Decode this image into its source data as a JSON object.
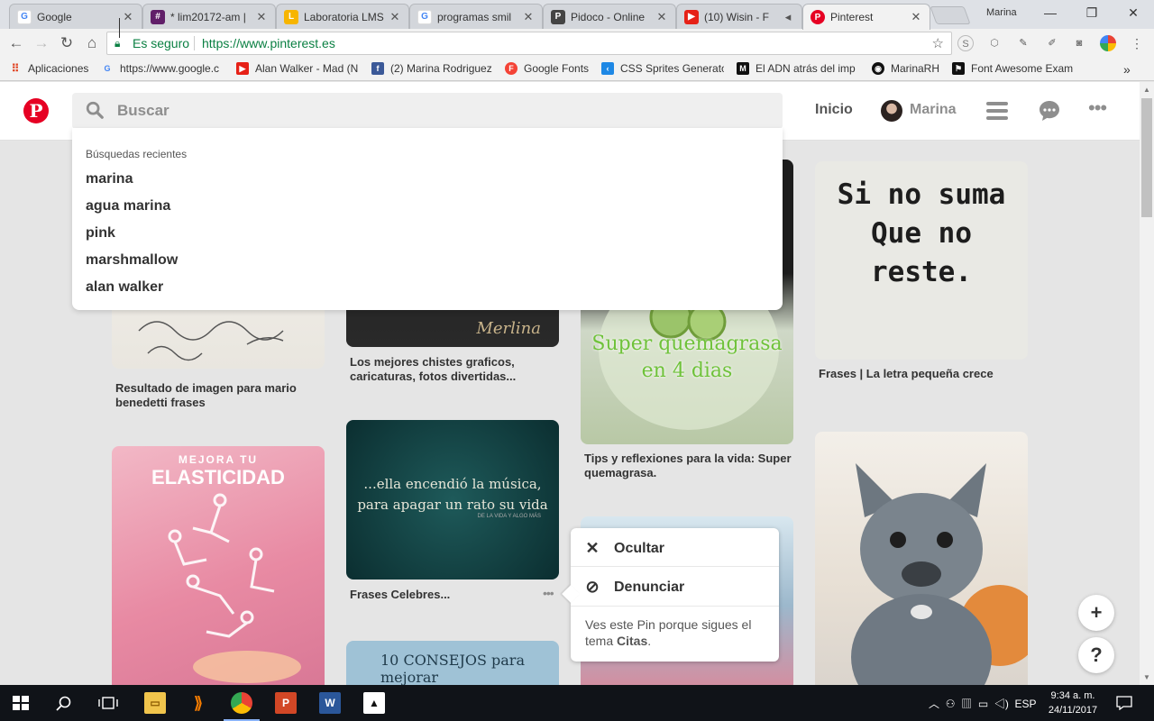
{
  "browser": {
    "tabs": [
      {
        "title": "Google",
        "icon": "google-icon"
      },
      {
        "title": "* lim20172-am |",
        "icon": "hash-icon"
      },
      {
        "title": "Laboratoria LMS",
        "icon": "laboratoria-icon"
      },
      {
        "title": "programas smil",
        "icon": "google-icon"
      },
      {
        "title": "Pidoco - Online",
        "icon": "pidoco-icon"
      },
      {
        "title": "(10) Wisin - F",
        "icon": "youtube-icon"
      },
      {
        "title": "Pinterest",
        "icon": "pinterest-icon"
      }
    ],
    "profile_name": "Marina",
    "secure_label": "Es seguro",
    "url": "https://www.pinterest.es",
    "bookmarks": [
      {
        "label": "Aplicaciones",
        "icon": "apps-icon"
      },
      {
        "label": "https://www.google.c",
        "icon": "google-icon"
      },
      {
        "label": "Alan Walker - Mad (N",
        "icon": "youtube-icon"
      },
      {
        "label": "(2) Marina Rodriguez",
        "icon": "facebook-icon"
      },
      {
        "label": "Google Fonts",
        "icon": "fonts-icon"
      },
      {
        "label": "CSS Sprites Generato",
        "icon": "sprites-icon"
      },
      {
        "label": "El ADN atrás del imp",
        "icon": "medium-icon"
      },
      {
        "label": "MarinaRH",
        "icon": "github-icon"
      },
      {
        "label": "Font Awesome Exam",
        "icon": "fontawesome-icon"
      }
    ]
  },
  "header": {
    "search_placeholder": "Buscar",
    "home_label": "Inicio",
    "user_name": "Marina"
  },
  "dropdown": {
    "heading": "Búsquedas recientes",
    "items": [
      "marina",
      "agua marina",
      "pink",
      "marshmallow",
      "alan walker"
    ]
  },
  "pins": {
    "captions": [
      "Resultado de imagen para mario benedetti frases",
      "Los mejores chistes graficos, caricaturas, fotos divertidas...",
      "Tips y reflexiones para la vida: Super quemagrasa.",
      "Frases | La letra pequeña crece",
      "Frases Celebres..."
    ],
    "image_texts": {
      "merlina": "Merlina",
      "quemagrasa": "Super quemagrasa en 4 dias",
      "si_no_suma": "Si no suma Que no reste.",
      "elasticidad_top": "MEJORA TU",
      "elasticidad": "ELASTICIDAD",
      "musica_line1": "...ella encendió la música,",
      "musica_line2": "para apagar un rato su vida",
      "musica_credit": "DE LA VIDA Y ALGO MÁS",
      "consejos": "10 CONSEJOS para mejorar"
    }
  },
  "popup": {
    "hide_label": "Ocultar",
    "report_label": "Denunciar",
    "info_text": "Ves este Pin porque sigues el tema",
    "topic": "Citas"
  },
  "fab": {
    "add": "+",
    "help": "?"
  },
  "taskbar": {
    "language": "ESP",
    "time": "9:34 a. m.",
    "date": "24/11/2017"
  }
}
